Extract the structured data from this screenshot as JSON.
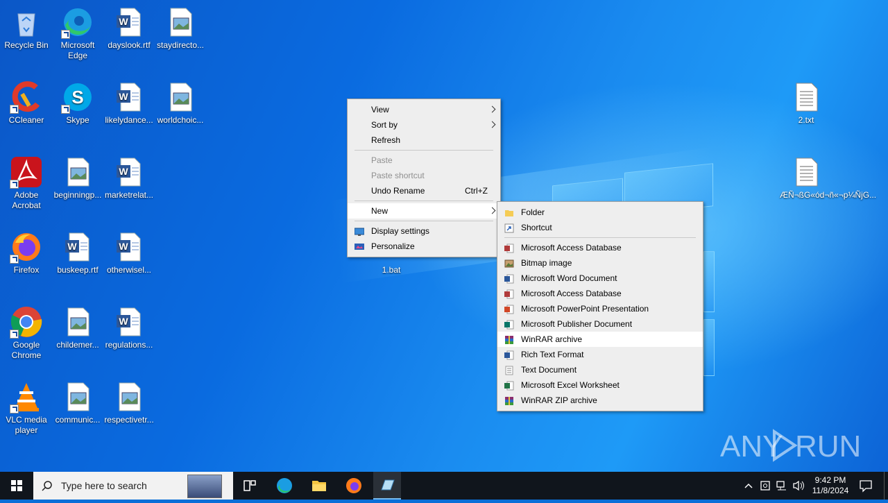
{
  "desktop_icons": [
    {
      "label": "Recycle Bin",
      "icon": "recycle-bin-icon"
    },
    {
      "label": "Microsoft Edge",
      "icon": "edge-icon"
    },
    {
      "label": "dayslook.rtf",
      "icon": "word-doc-icon"
    },
    {
      "label": "staydirecto...",
      "icon": "image-file-icon"
    },
    {
      "label": "CCleaner",
      "icon": "ccleaner-icon"
    },
    {
      "label": "Skype",
      "icon": "skype-icon"
    },
    {
      "label": "likelydance...",
      "icon": "word-doc-icon"
    },
    {
      "label": "worldchoic...",
      "icon": "image-file-icon"
    },
    {
      "label": "Adobe Acrobat",
      "icon": "acrobat-icon"
    },
    {
      "label": "beginningp...",
      "icon": "image-file-icon"
    },
    {
      "label": "marketrelat...",
      "icon": "word-doc-icon"
    },
    {
      "label": "Firefox",
      "icon": "firefox-icon"
    },
    {
      "label": "buskeep.rtf",
      "icon": "word-doc-icon"
    },
    {
      "label": "otherwisel...",
      "icon": "word-doc-icon"
    },
    {
      "label": "Google Chrome",
      "icon": "chrome-icon"
    },
    {
      "label": "childemer...",
      "icon": "image-file-icon"
    },
    {
      "label": "regulations...",
      "icon": "word-doc-icon"
    },
    {
      "label": "VLC media player",
      "icon": "vlc-icon"
    },
    {
      "label": "communic...",
      "icon": "image-file-icon"
    },
    {
      "label": "respectivetr...",
      "icon": "image-file-icon"
    },
    {
      "label": "2.txt",
      "icon": "text-file-icon"
    },
    {
      "label": "ÆÑ¬ßG«ód¬ñ«¬p¼ÑjG...",
      "icon": "text-file-icon"
    },
    {
      "label": "1.bat",
      "icon": "bat-file-icon"
    }
  ],
  "context_menu": {
    "items": [
      {
        "label": "View"
      },
      {
        "label": "Sort by"
      },
      {
        "label": "Refresh"
      },
      {
        "label": "Paste"
      },
      {
        "label": "Paste shortcut"
      },
      {
        "label": "Undo Rename",
        "accel": "Ctrl+Z"
      },
      {
        "label": "New"
      },
      {
        "label": "Display settings"
      },
      {
        "label": "Personalize"
      }
    ]
  },
  "new_submenu": {
    "items": [
      {
        "label": "Folder",
        "icon": "folder-icon",
        "color": "#f5cc55"
      },
      {
        "label": "Shortcut",
        "icon": "shortcut-icon",
        "color": "#2a62b8"
      },
      {
        "label": "Microsoft Access Database",
        "icon": "access-icon",
        "color": "#b03a3a"
      },
      {
        "label": "Bitmap image",
        "icon": "bitmap-icon",
        "color": "#c8a070"
      },
      {
        "label": "Microsoft Word Document",
        "icon": "word-icon",
        "color": "#2b579a"
      },
      {
        "label": "Microsoft Access Database",
        "icon": "access-icon",
        "color": "#b03a3a"
      },
      {
        "label": "Microsoft PowerPoint Presentation",
        "icon": "powerpoint-icon",
        "color": "#d24726"
      },
      {
        "label": "Microsoft Publisher Document",
        "icon": "publisher-icon",
        "color": "#077568"
      },
      {
        "label": "WinRAR archive",
        "icon": "winrar-icon",
        "color": "#8a2d6e"
      },
      {
        "label": "Rich Text Format",
        "icon": "rtf-icon",
        "color": "#2b579a"
      },
      {
        "label": "Text Document",
        "icon": "text-doc-icon",
        "color": "#9a9a9a"
      },
      {
        "label": "Microsoft Excel Worksheet",
        "icon": "excel-icon",
        "color": "#217346"
      },
      {
        "label": "WinRAR ZIP archive",
        "icon": "winrar-zip-icon",
        "color": "#8a2d6e"
      }
    ]
  },
  "taskbar": {
    "search_placeholder": "Type here to search",
    "time": "9:42 PM",
    "date": "11/8/2024"
  },
  "watermark": "ANY RUN"
}
